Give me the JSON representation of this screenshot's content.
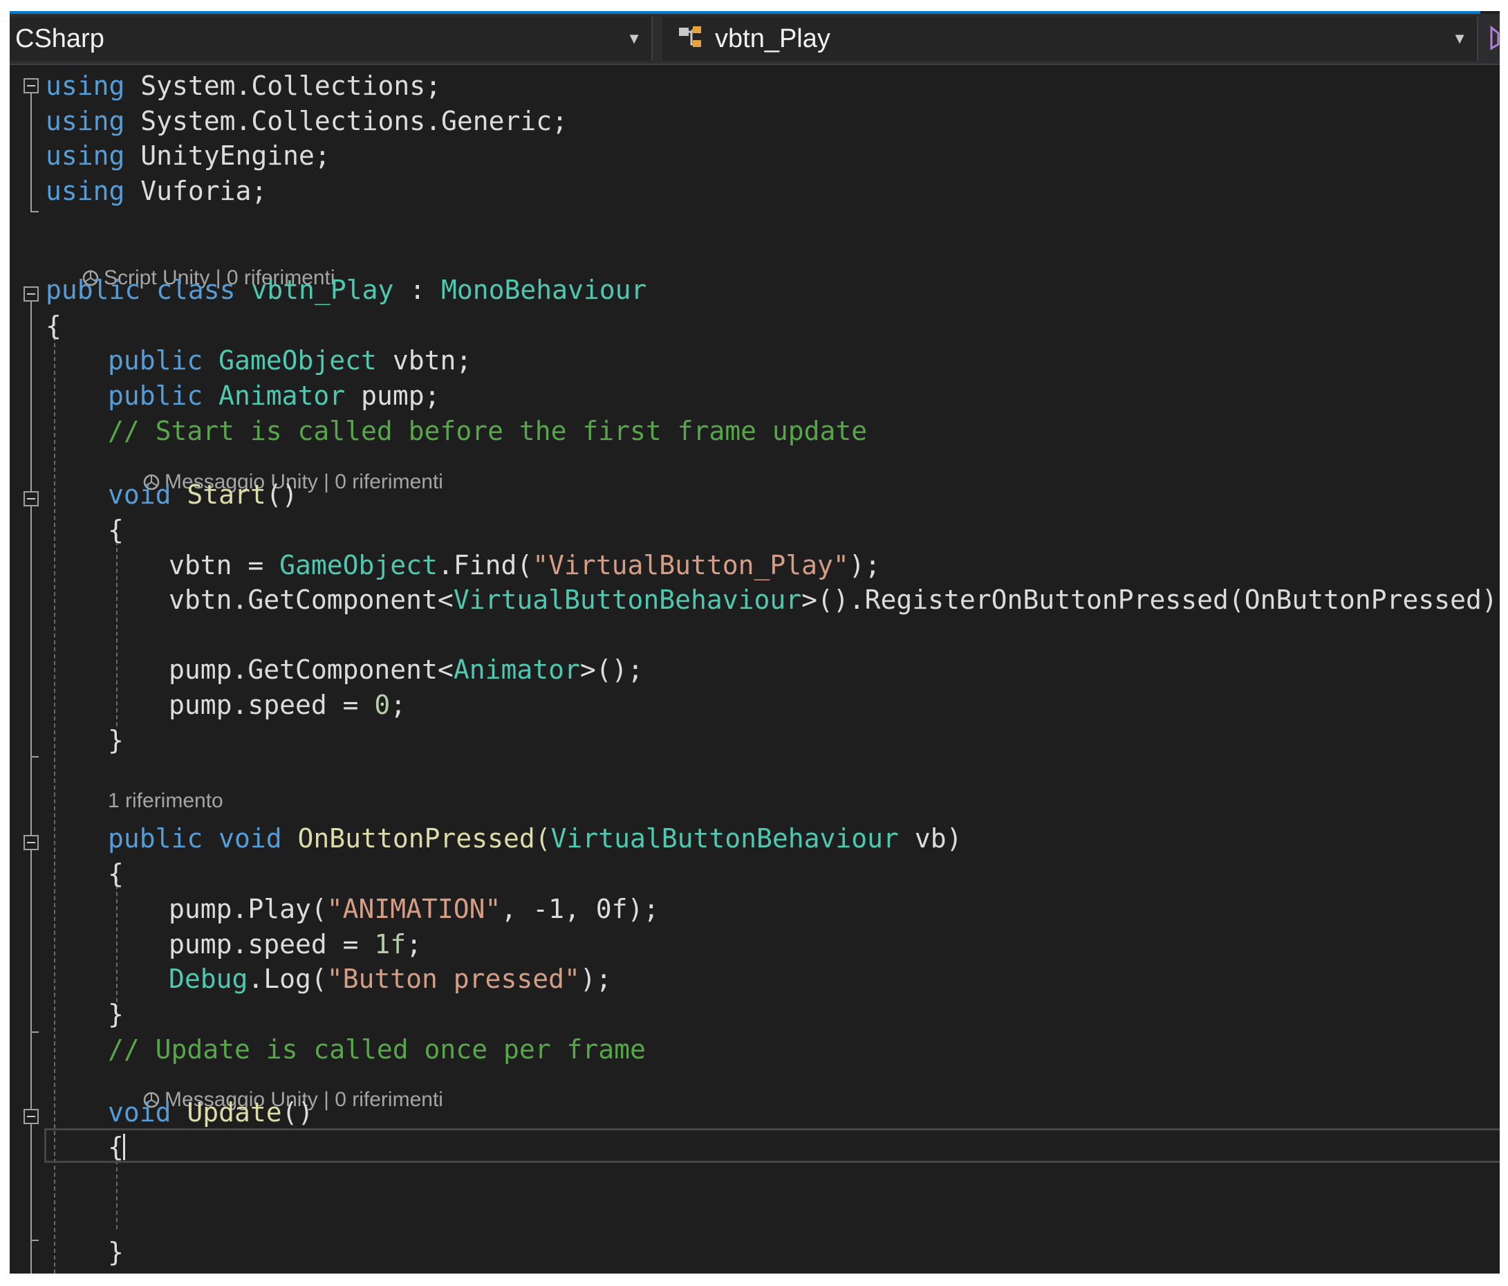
{
  "nav": {
    "project": "CSharp",
    "class_name": "vbtn_Play",
    "project_chevron_icon": "chevron-down-icon",
    "class_chevron_icon": "chevron-down-icon",
    "class_icon": "class-icon"
  },
  "code_lens": {
    "script_unity": "Script Unity | 0 riferimenti",
    "start_msg": "Messaggio Unity | 0 riferimenti",
    "onbutton_refs": "1 riferimento",
    "update_msg": "Messaggio Unity | 0 riferimenti"
  },
  "code": {
    "l1_kw": "using",
    "l1_rest": " System.Collections;",
    "l2_kw": "using",
    "l2_rest": " System.Collections.Generic;",
    "l3_kw": "using",
    "l3_rest": " UnityEngine;",
    "l4_kw": "using",
    "l4_rest": " Vuforia;",
    "class_kw": "public class",
    "class_name": " vbtn_Play",
    "class_colon": " : ",
    "class_base": "MonoBehaviour",
    "open_brace": "{",
    "close_brace": "}",
    "f1_kw": "public",
    "f1_type": " GameObject",
    "f1_name": " vbtn;",
    "f2_kw": "public",
    "f2_type": " Animator",
    "f2_name": " pump;",
    "comment_start": "// Start is called before the first frame update",
    "start_kw": "void",
    "start_name": " Start",
    "start_paren": "()",
    "s1_a": "vbtn = ",
    "s1_type": "GameObject",
    "s1_b": ".Find(",
    "s1_str": "\"VirtualButton_Play\"",
    "s1_c": ");",
    "s2_a": "vbtn.GetComponent<",
    "s2_type": "VirtualButtonBehaviour",
    "s2_b": ">().RegisterOnButtonPressed(OnButtonPressed);",
    "s3_a": "pump.GetComponent<",
    "s3_type": "Animator",
    "s3_b": ">();",
    "s4_a": "pump.speed = ",
    "s4_num": "0",
    "s4_b": ";",
    "ob_kw": "public void",
    "ob_name": " OnButtonPressed(",
    "ob_type": "VirtualButtonBehaviour",
    "ob_param": " vb)",
    "p1_a": "pump.Play(",
    "p1_str": "\"ANIMATION\"",
    "p1_b": ", -1, 0f);",
    "p2_a": "pump.speed = ",
    "p2_num": "1f",
    "p2_b": ";",
    "p3_type": "Debug",
    "p3_a": ".Log(",
    "p3_str": "\"Button pressed\"",
    "p3_b": ");",
    "comment_update": "// Update is called once per frame",
    "update_kw": "void",
    "update_name": " Update",
    "update_paren": "()"
  },
  "colors": {
    "background": "#1e1e1e",
    "keyword": "#569cd6",
    "type": "#4ec9b0",
    "comment": "#57a64a",
    "string": "#d69d85",
    "number": "#b5cea8",
    "plain": "#dcdcdc",
    "accent": "#007acc"
  }
}
